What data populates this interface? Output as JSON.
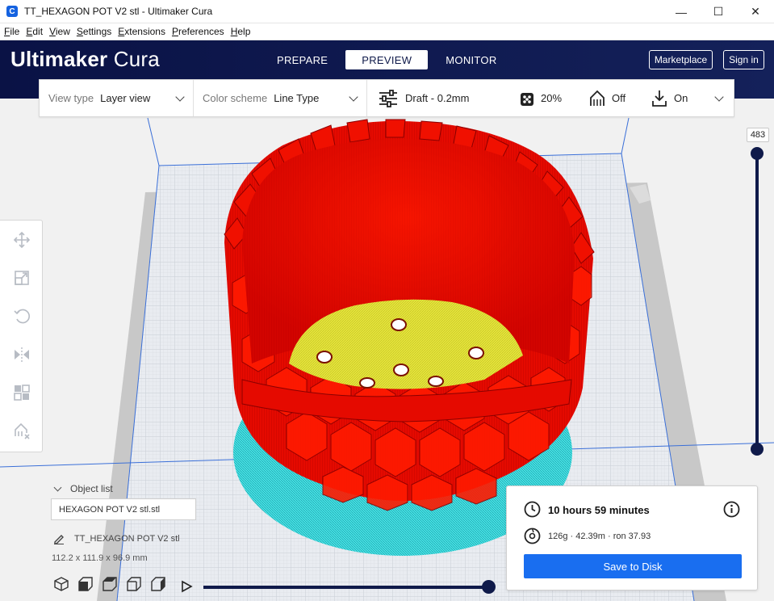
{
  "window": {
    "app_icon_letter": "C",
    "title": "TT_HEXAGON POT V2 stl - Ultimaker Cura",
    "controls": {
      "minimize": "—",
      "maximize": "☐",
      "close": "✕"
    }
  },
  "menubar": {
    "items": [
      {
        "key": "F",
        "rest": "ile"
      },
      {
        "key": "E",
        "rest": "dit"
      },
      {
        "key": "V",
        "rest": "iew"
      },
      {
        "key": "S",
        "rest": "ettings"
      },
      {
        "key": "E",
        "rest": "xtensions"
      },
      {
        "key": "P",
        "rest": "references"
      },
      {
        "key": "H",
        "rest": "elp"
      }
    ]
  },
  "header": {
    "logo_bold": "Ultimaker",
    "logo_light": "Cura",
    "tabs": [
      {
        "label": "PREPARE"
      },
      {
        "label": "PREVIEW"
      },
      {
        "label": "MONITOR"
      }
    ],
    "active_tab": "PREVIEW",
    "marketplace_label": "Marketplace",
    "signin_label": "Sign in"
  },
  "toolbar": {
    "view_type_label": "View type",
    "view_type_value": "Layer view",
    "color_scheme_label": "Color scheme",
    "color_scheme_value": "Line Type",
    "profile": "Draft - 0.2mm",
    "infill": "20%",
    "support": "Off",
    "adhesion": "On"
  },
  "layer_slider": {
    "value": "483"
  },
  "object_list": {
    "header": "Object list",
    "file": "HEXAGON POT V2 stl.stl",
    "object_name": "TT_HEXAGON POT V2 stl",
    "dimensions": "112.2 x 111.9 x 96.9 mm"
  },
  "playback": {
    "progress": 1.0
  },
  "print_info": {
    "time": "10 hours 59 minutes",
    "material": "126g · 42.39m · ron 37.93",
    "save_label": "Save to Disk"
  },
  "colors": {
    "header_bg": "#0f1a4a",
    "accent_blue": "#196ef0",
    "wall_red": "#e00000",
    "infill_yellow": "#e6e03a",
    "skirt_cyan": "#3fe0e0"
  }
}
